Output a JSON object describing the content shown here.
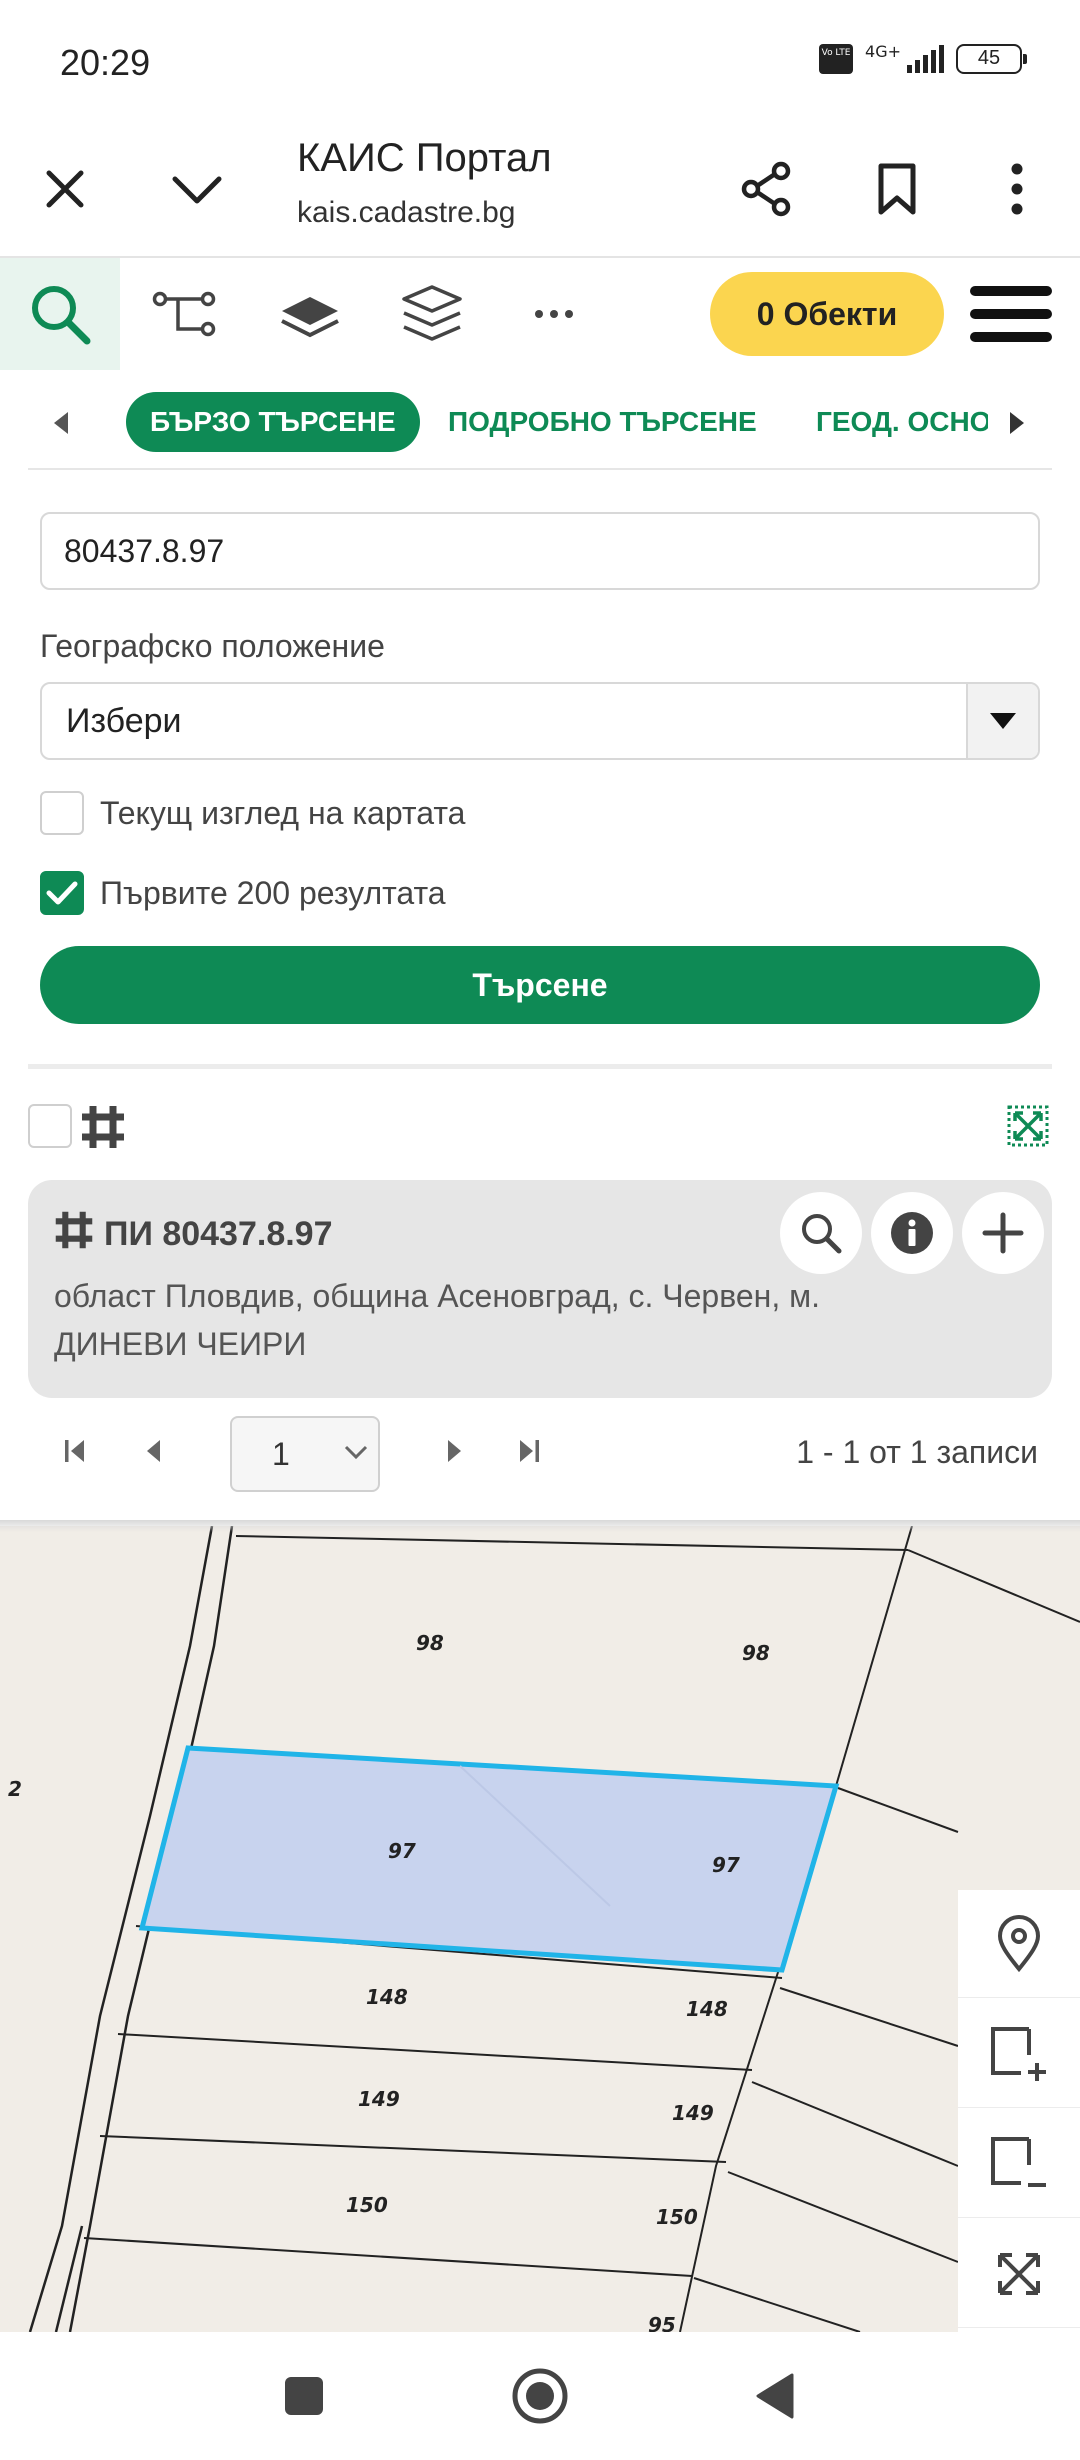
{
  "status": {
    "time": "20:29",
    "network": "4G+",
    "volte": "Vo LTE",
    "battery": "45"
  },
  "browser": {
    "title": "КАИС Портал",
    "url": "kais.cadastre.bg"
  },
  "toolbar": {
    "objects_label": "0 Обекти"
  },
  "tabs": {
    "quick": "БЪРЗО ТЪРСЕНЕ",
    "detailed": "ПОДРОБНО ТЪРСЕНЕ",
    "geo": "ГЕОД. ОСНОВА"
  },
  "form": {
    "search_value": "80437.8.97",
    "geo_label": "Географско положение",
    "geo_value": "Избери",
    "current_view_label": "Текущ изглед на картата",
    "current_view_checked": false,
    "first200_label": "Първите 200 резултата",
    "first200_checked": true,
    "search_button": "Търсене"
  },
  "result": {
    "title": "ПИ 80437.8.97",
    "address": "област Пловдив, община Асеновград, с. Червен, м. ДИНЕВИ ЧЕИРИ"
  },
  "pager": {
    "page": "1",
    "info": "1 - 1 от 1 записи"
  },
  "map": {
    "labels": [
      "2",
      "98",
      "98",
      "97",
      "97",
      "148",
      "148",
      "149",
      "149",
      "150",
      "150",
      "95"
    ],
    "highlight_fill": "#c8d3ee",
    "highlight_stroke": "#20b4e8"
  },
  "colors": {
    "brand_green": "#0e8a55",
    "objects_yellow": "#fbd54f"
  }
}
